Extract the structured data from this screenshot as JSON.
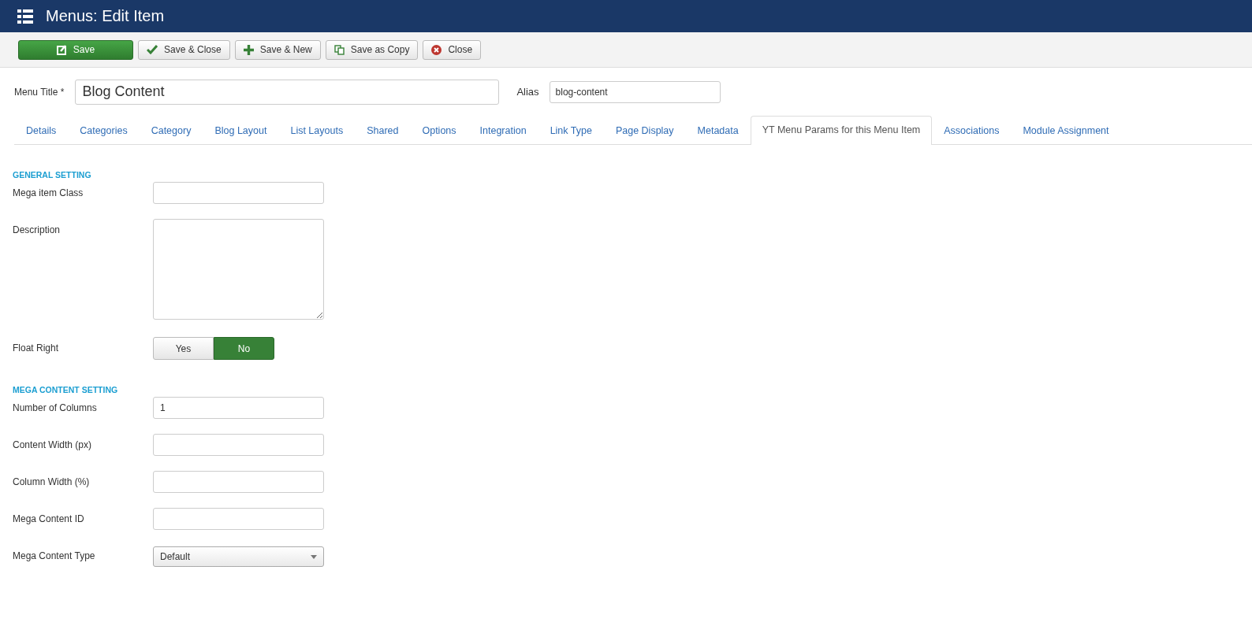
{
  "header": {
    "title": "Menus: Edit Item"
  },
  "toolbar": [
    {
      "label": "Save",
      "kind": "primary"
    },
    {
      "label": "Save & Close",
      "kind": "default"
    },
    {
      "label": "Save & New",
      "kind": "default"
    },
    {
      "label": "Save as Copy",
      "kind": "default"
    },
    {
      "label": "Close",
      "kind": "default"
    }
  ],
  "title_row": {
    "menu_title_label": "Menu Title *",
    "menu_title_value": "Blog Content",
    "alias_label": "Alias",
    "alias_value": "blog-content"
  },
  "tabs": [
    {
      "label": "Details",
      "selected": false
    },
    {
      "label": "Categories",
      "selected": false
    },
    {
      "label": "Category",
      "selected": false
    },
    {
      "label": "Blog Layout",
      "selected": false
    },
    {
      "label": "List Layouts",
      "selected": false
    },
    {
      "label": "Shared",
      "selected": false
    },
    {
      "label": "Options",
      "selected": false
    },
    {
      "label": "Integration",
      "selected": false
    },
    {
      "label": "Link Type",
      "selected": false
    },
    {
      "label": "Page Display",
      "selected": false
    },
    {
      "label": "Metadata",
      "selected": false
    },
    {
      "label": "YT Menu Params for this Menu Item",
      "selected": true
    },
    {
      "label": "Associations",
      "selected": false
    },
    {
      "label": "Module Assignment",
      "selected": false
    }
  ],
  "sections": [
    {
      "heading": "GENERAL SETTING",
      "fields": [
        {
          "kind": "text",
          "label": "Mega item Class"
        },
        {
          "kind": "textarea",
          "label": "Description"
        },
        {
          "kind": "toggle",
          "label": "Float Right",
          "options": [
            {
              "label": "Yes",
              "selected": false
            },
            {
              "label": "No",
              "selected": true
            }
          ]
        }
      ]
    },
    {
      "heading": "MEGA CONTENT SETTING",
      "fields": [
        {
          "kind": "text",
          "label": "Number of Columns",
          "value": "1"
        },
        {
          "kind": "text",
          "label": "Content Width (px)"
        },
        {
          "kind": "text",
          "label": "Column Width (%)"
        },
        {
          "kind": "text",
          "label": "Mega Content ID"
        },
        {
          "kind": "select",
          "label": "Mega Content Type",
          "value": "Default"
        }
      ]
    }
  ]
}
